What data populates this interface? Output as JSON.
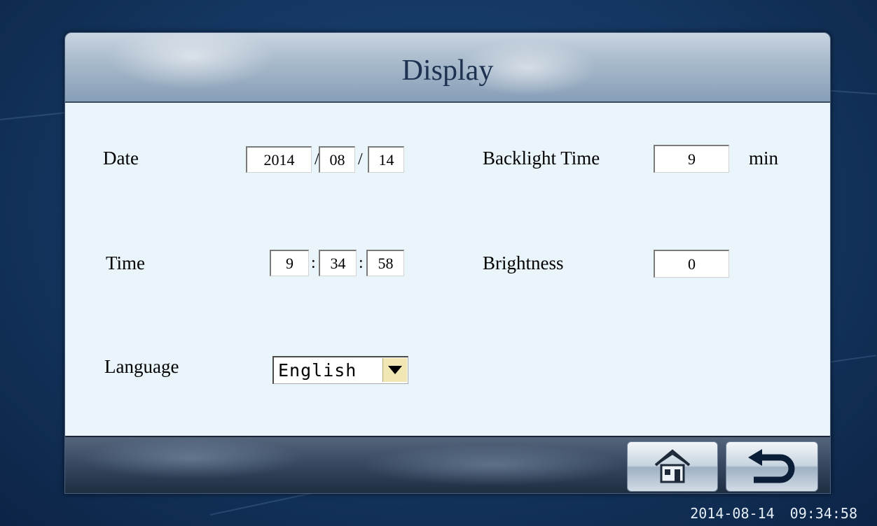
{
  "screen": {
    "title": "Display"
  },
  "date": {
    "label": "Date",
    "year": "2014",
    "month": "08",
    "day": "14",
    "separator": "/"
  },
  "time": {
    "label": "Time",
    "hour": "9",
    "minute": "34",
    "second": "58",
    "separator": ":"
  },
  "language": {
    "label": "Language",
    "selected": "English"
  },
  "backlight": {
    "label": "Backlight Time",
    "value": "9",
    "unit": "min"
  },
  "brightness": {
    "label": "Brightness",
    "value": "0"
  },
  "footer": {
    "home_icon": "home-icon",
    "back_icon": "return-arrow-icon"
  },
  "status": {
    "date": "2014-08-14",
    "time": "09:34:58"
  },
  "colors": {
    "background": "#143660",
    "content": "#e9f4fb",
    "title_text": "#1d3150",
    "dropdown_button": "#f0e7b4"
  }
}
